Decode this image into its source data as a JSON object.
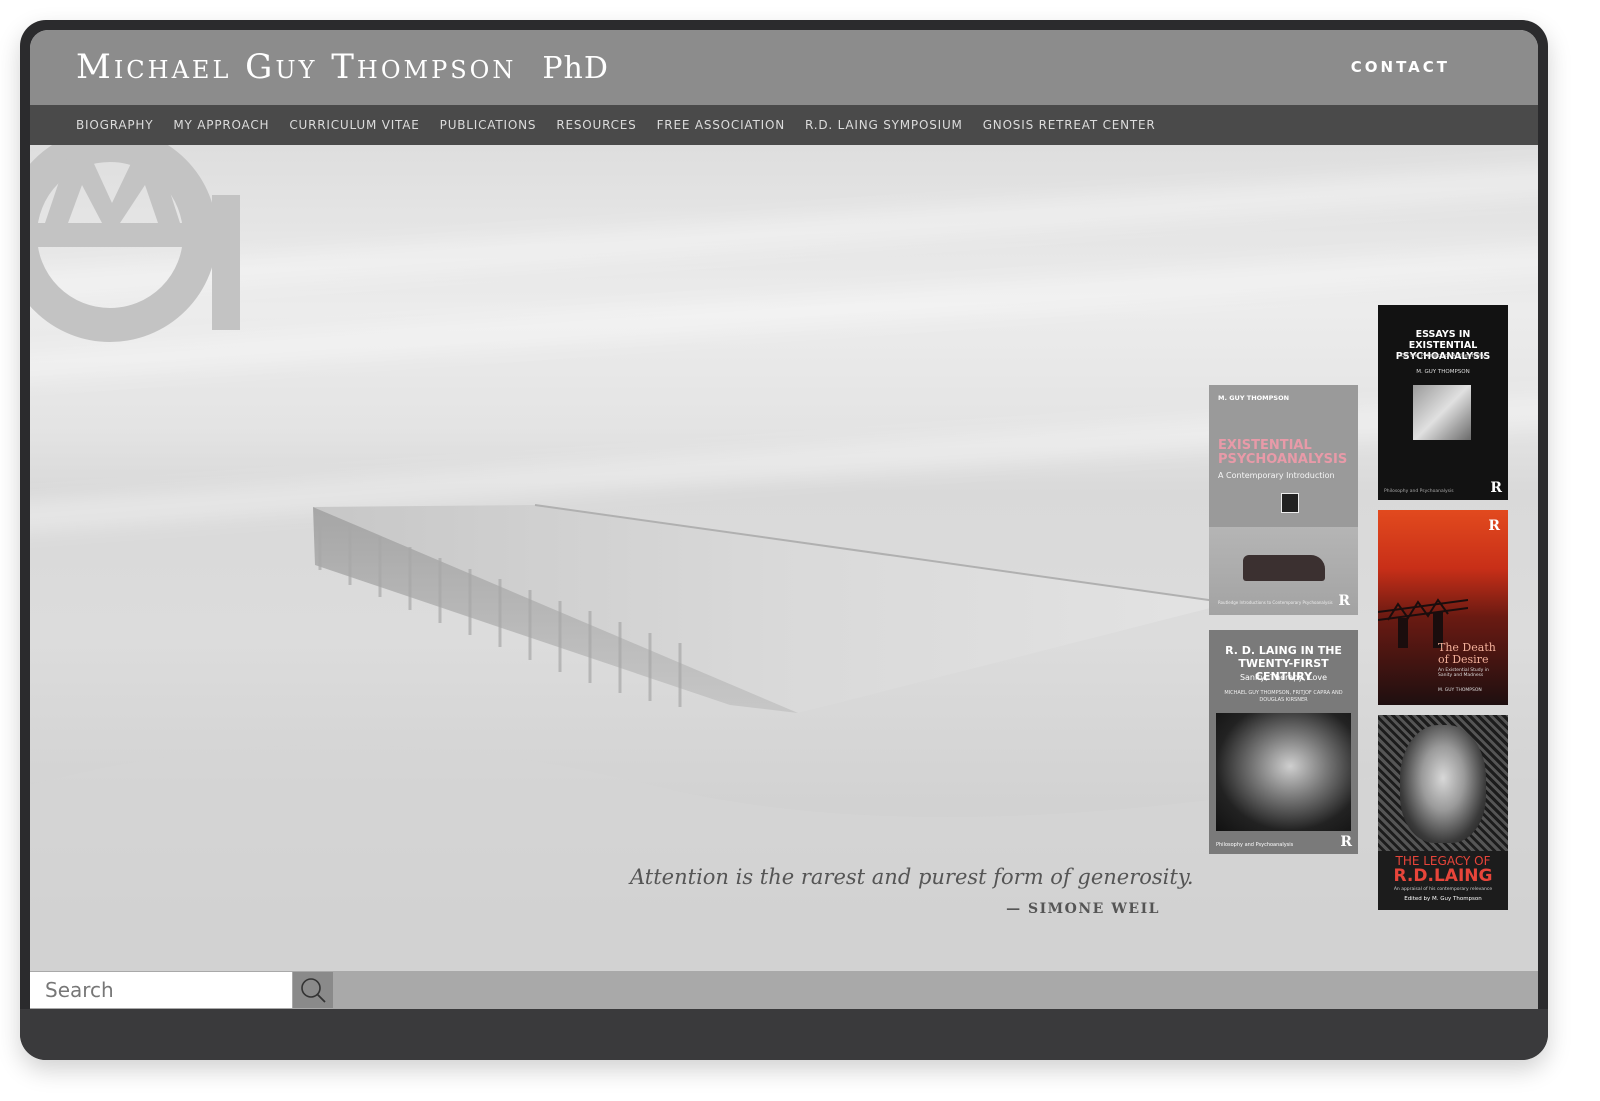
{
  "site": {
    "title": "Michael Guy Thompson",
    "degree": "PhD",
    "contact_label": "CONTACT"
  },
  "nav": {
    "items": [
      {
        "label": "BIOGRAPHY"
      },
      {
        "label": "MY APPROACH"
      },
      {
        "label": "CURRICULUM VITAE"
      },
      {
        "label": "PUBLICATIONS"
      },
      {
        "label": "RESOURCES"
      },
      {
        "label": "FREE ASSOCIATION"
      },
      {
        "label": "R.D. LAING SYMPOSIUM"
      },
      {
        "label": "GNOSIS RETREAT CENTER"
      }
    ]
  },
  "hero": {
    "quote": "Attention is the rarest and purest form of generosity.",
    "quote_author": "— SIMONE WEIL",
    "logo_icon": "mgt-monogram-icon"
  },
  "books": {
    "essays": {
      "title": "ESSAYS IN EXISTENTIAL PSYCHOANALYSIS",
      "subtitle": "On the Primacy of Authenticity",
      "author": "M. GUY THOMPSON",
      "series": "Philosophy and Psychoanalysis",
      "publisher_mark": "R"
    },
    "existential": {
      "author": "M. GUY THOMPSON",
      "title": "EXISTENTIAL PSYCHOANALYSIS",
      "subtitle": "A Contemporary Introduction",
      "series": "Routledge Introductions to Contemporary Psychoanalysis",
      "publisher_mark": "R"
    },
    "death_of_desire": {
      "title": "The Death of Desire",
      "subtitle": "An Existential Study in Sanity and Madness",
      "author": "M. GUY THOMPSON",
      "publisher_mark": "R"
    },
    "laing_21": {
      "title": "R. D. LAING IN THE TWENTY-FIRST CENTURY",
      "subtitle": "Sanity, Therapy, Love",
      "authors": "MICHAEL GUY THOMPSON, FRITJOF CAPRA AND DOUGLAS KIRSNER",
      "series": "Philosophy and Psychoanalysis",
      "publisher_mark": "R"
    },
    "legacy": {
      "title_top": "THE LEGACY OF",
      "title_main": "R.D.LAING",
      "subtitle": "An appraisal of his contemporary relevance",
      "editor": "Edited by M. Guy Thompson"
    }
  },
  "search": {
    "placeholder": "Search",
    "icon": "search-icon"
  },
  "colors": {
    "header_bg": "#8c8c8c",
    "nav_bg": "#4a4a4a",
    "accent_red": "#e8453a",
    "accent_pink": "#e89aa8"
  }
}
